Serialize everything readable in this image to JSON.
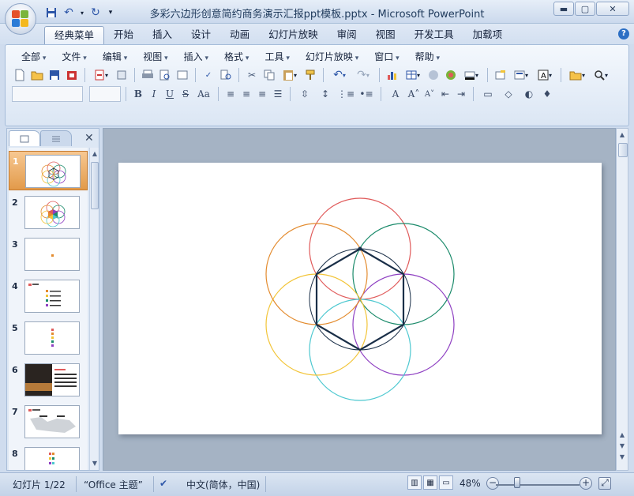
{
  "window": {
    "title": "多彩六边形创意简约商务演示汇报ppt模板.pptx - Microsoft PowerPoint"
  },
  "ribbon_tabs": [
    "经典菜单",
    "开始",
    "插入",
    "设计",
    "动画",
    "幻灯片放映",
    "审阅",
    "视图",
    "开发工具",
    "加载项"
  ],
  "classic_menu": [
    "全部",
    "文件",
    "编辑",
    "视图",
    "插入",
    "格式",
    "工具",
    "幻灯片放映",
    "窗口",
    "帮助"
  ],
  "thumbnails": [
    {
      "num": "1"
    },
    {
      "num": "2"
    },
    {
      "num": "3"
    },
    {
      "num": "4"
    },
    {
      "num": "5"
    },
    {
      "num": "6"
    },
    {
      "num": "7"
    },
    {
      "num": "8"
    }
  ],
  "status": {
    "slide_info": "幻灯片 1/22",
    "theme": "“Office 主题”",
    "language": "中文(简体，中国)",
    "zoom": "48%"
  },
  "slide_content": {
    "circle_colors": [
      "#e05a5a",
      "#1a8a6a",
      "#8e3fc2",
      "#4dc8d0",
      "#f2c437",
      "#e38b2e"
    ],
    "hexagon_color": "#1a2f48"
  },
  "colors": {
    "accent": "#2c6fc4",
    "selected_thumb": "#e29a4a"
  }
}
